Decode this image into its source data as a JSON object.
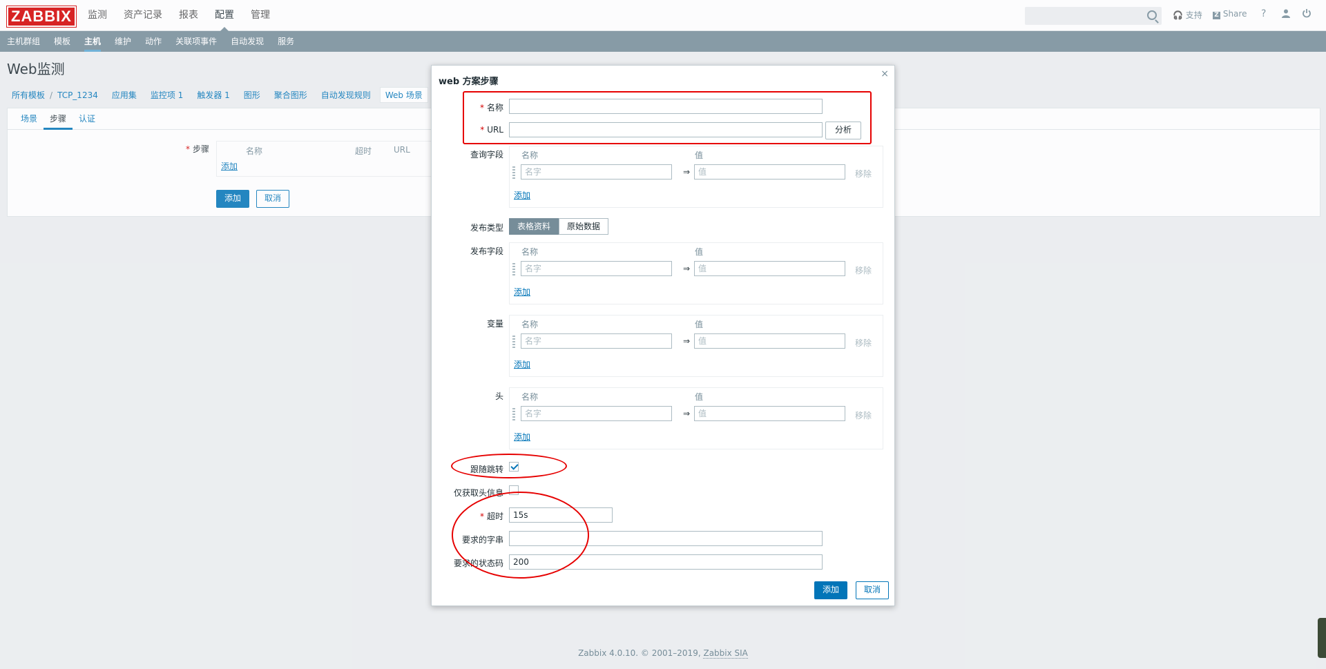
{
  "header": {
    "logo": "ZABBIX",
    "menu": [
      "监测",
      "资产记录",
      "报表",
      "配置",
      "管理"
    ],
    "menu_selected_index": 3,
    "support": "支持",
    "share": "Share",
    "help": "?"
  },
  "subnav": {
    "items": [
      "主机群组",
      "模板",
      "主机",
      "维护",
      "动作",
      "关联项事件",
      "自动发现",
      "服务"
    ],
    "selected_index": 2
  },
  "page": {
    "title": "Web监测",
    "breadcrumbs": [
      "所有模板",
      "TCP_1234",
      "应用集",
      "监控项 1",
      "触发器 1",
      "图形",
      "聚合图形",
      "自动发现规则",
      "Web 场景"
    ],
    "tabs": [
      "场景",
      "步骤",
      "认证"
    ],
    "steps_label": "步骤",
    "steps_cols": [
      "名称",
      "超时",
      "URL"
    ],
    "steps_add": "添加",
    "add_button": "添加",
    "cancel_button": "取消"
  },
  "dialog": {
    "title": "web 方案步骤",
    "close": "×",
    "name_label": "名称",
    "url_label": "URL",
    "name_value": "",
    "url_value": "",
    "analyze": "分析",
    "query_label": "查询字段",
    "post_type_label": "发布类型",
    "post_type_options": [
      "表格资料",
      "原始数据"
    ],
    "post_fields_label": "发布字段",
    "variables_label": "变量",
    "headers_label": "头",
    "col_name": "名称",
    "col_value": "值",
    "name_placeholder": "名字",
    "value_placeholder": "值",
    "arrow": "⇒",
    "remove": "移除",
    "add_link": "添加",
    "follow_redirects_label": "跟随跳转",
    "follow_redirects_checked": true,
    "retrieve_headers_label": "仅获取头信息",
    "retrieve_headers_checked": false,
    "timeout_label": "超时",
    "timeout_value": "15s",
    "required_string_label": "要求的字串",
    "required_string_value": "",
    "status_codes_label": "要求的状态码",
    "status_codes_value": "200",
    "add_button": "添加",
    "cancel_button": "取消"
  },
  "footer": {
    "text": "Zabbix 4.0.10. © 2001–2019, ",
    "link": "Zabbix SIA"
  },
  "colors": {
    "brand_red": "#d40000",
    "nav_gray": "#768d99",
    "link_blue": "#0275b8",
    "annotation_red": "#e60000"
  }
}
